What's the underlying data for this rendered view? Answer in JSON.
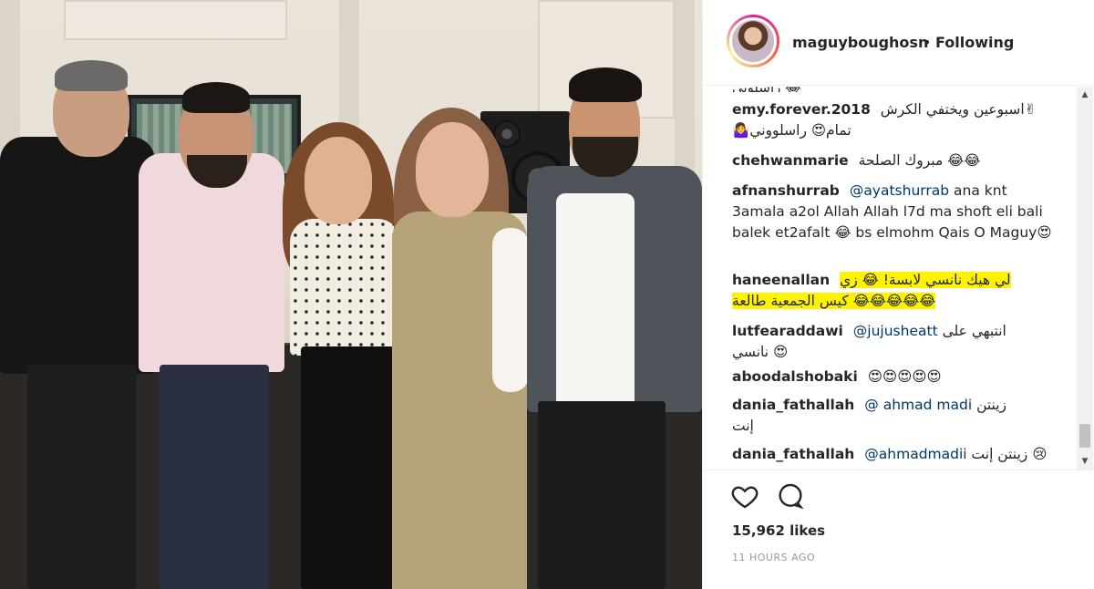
{
  "post": {
    "username": "maguyboughosn",
    "separator": "•",
    "follow_status": "Following",
    "likes": "15,962 likes",
    "timestamp": "11 HOURS AGO"
  },
  "comments": [
    {
      "username": "emy.forever.2018",
      "text": "اسبوعين ويختفي الكرش✌",
      "text2": "🤷‍♀️تمام😍 راسلووني",
      "highlighted": false
    },
    {
      "username": "chehwanmarie",
      "text": "مبروك الصلحة 😂😂",
      "highlighted": false
    },
    {
      "username": "afnanshurrab",
      "mention": "@ayatshurrab",
      "text": "ana knt 3amala a2ol Allah Allah l7d ma shoft eli bali balek et2afalt 😂 bs elmohm Qais O Maguy😍",
      "highlighted": false
    },
    {
      "username": "haneenallan",
      "text": "لي هيك نانسي لابسة! 😂 زي",
      "text2": "كيس الجمعية طالعة 😂😂😂😂😂",
      "highlighted": true
    },
    {
      "username": "lutfearaddawi",
      "mention": "@jujusheatt",
      "text": "انتبهي على",
      "text2": "نانسي 😍",
      "highlighted": false
    },
    {
      "username": "aboodalshobaki",
      "text": "😍😍😍😍😍",
      "highlighted": false
    },
    {
      "username": "dania_fathallah",
      "mention": "@ ahmad madi",
      "text": "زينتن",
      "text2": "إنت",
      "highlighted": false
    },
    {
      "username": "dania_fathallah",
      "mention": "@ahmadmadii",
      "text": "زينتن إنت 😢",
      "highlighted": false
    }
  ],
  "colors": {
    "highlight": "#fff200",
    "mention": "#003569",
    "text": "#262626",
    "muted": "#999999"
  },
  "icons": [
    "heart-icon",
    "comment-bubble-icon",
    "scroll-up-arrow-icon",
    "scroll-down-arrow-icon"
  ]
}
